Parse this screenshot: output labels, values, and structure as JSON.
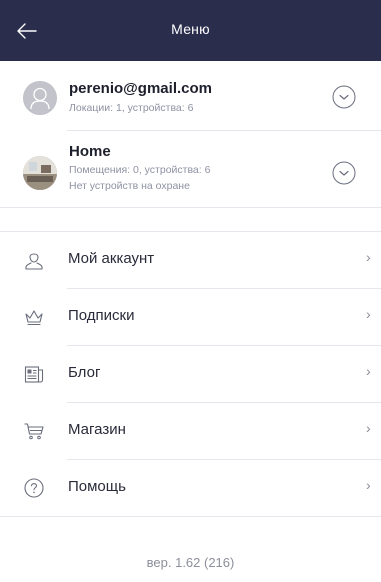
{
  "header": {
    "title": "Меню"
  },
  "accounts": [
    {
      "email": "perenio@gmail.com",
      "summary": "Локации: 1, устройства: 6"
    },
    {
      "name": "Home",
      "summary": "Помещения: 0, устройства: 6",
      "security": "Нет устройств на охране"
    }
  ],
  "menu": [
    {
      "label": "Мой аккаунт",
      "icon": "user-icon"
    },
    {
      "label": "Подписки",
      "icon": "crown-icon"
    },
    {
      "label": "Блог",
      "icon": "newspaper-icon"
    },
    {
      "label": "Магазин",
      "icon": "cart-icon"
    },
    {
      "label": "Помощь",
      "icon": "help-icon"
    }
  ],
  "footer": {
    "version": "вер. 1.62 (216)"
  },
  "colors": {
    "header_bg": "#2b2d4d",
    "text_primary": "#1e1f2c",
    "text_secondary": "#8f92a3"
  }
}
